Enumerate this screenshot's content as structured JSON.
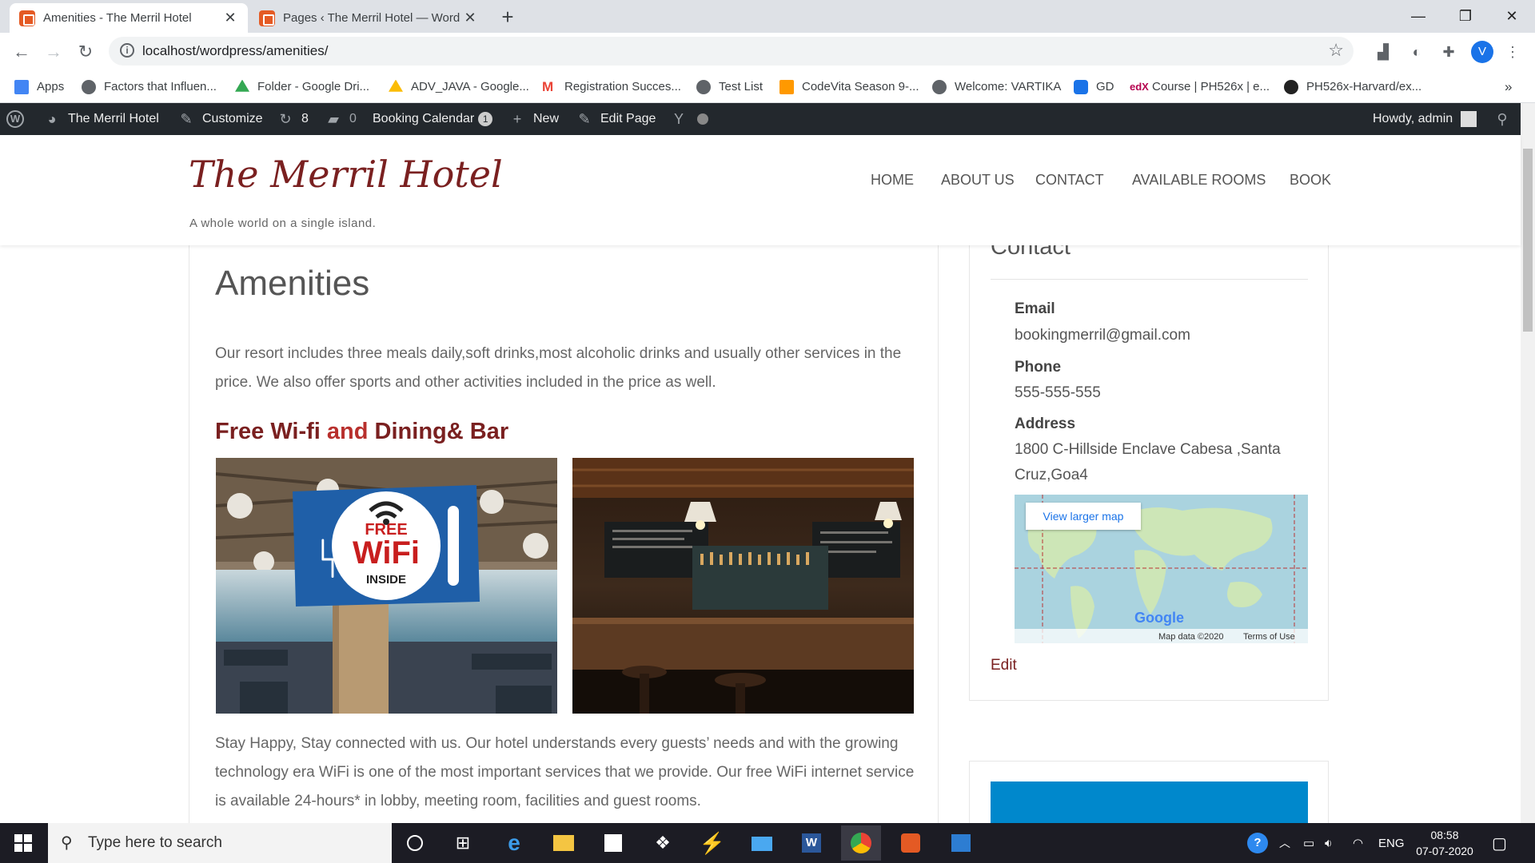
{
  "tabs": [
    {
      "title": "Amenities - The Merril Hotel",
      "close": "✕"
    },
    {
      "title": "Pages ‹ The Merril Hotel — Word",
      "close": "✕"
    }
  ],
  "new_tab_label": "+",
  "window_controls": {
    "minimize": "—",
    "restore": "❐",
    "close": "✕"
  },
  "toolbar": {
    "back": "←",
    "forward": "→",
    "reload": "↻",
    "url": "localhost/wordpress/amenities/",
    "star": "☆",
    "profile_initial": "V"
  },
  "bookmarks": [
    {
      "label": "Apps",
      "color": "#4285f4"
    },
    {
      "label": "Factors that Influen...",
      "color": "#5f6368"
    },
    {
      "label": "Folder - Google Dri...",
      "color": "#34a853"
    },
    {
      "label": "ADV_JAVA - Google...",
      "color": "#fbbc05"
    },
    {
      "label": "Registration Succes...",
      "color": "#ea4335"
    },
    {
      "label": "Test List",
      "color": "#5f6368"
    },
    {
      "label": "CodeVita Season 9-...",
      "color": "#ff9900"
    },
    {
      "label": "Welcome: VARTIKA",
      "color": "#5f6368"
    },
    {
      "label": "GD",
      "color": "#1a73e8"
    },
    {
      "label": "Course | PH526x | e...",
      "color": "#b5004e"
    },
    {
      "label": "PH526x-Harvard/ex...",
      "color": "#222222"
    }
  ],
  "bookmarks_more": "»",
  "adminbar": {
    "site_name": "The Merril Hotel",
    "customize": "Customize",
    "updates": "8",
    "comments": "0",
    "booking_calendar": "Booking Calendar",
    "booking_badge": "1",
    "new": "New",
    "edit_page": "Edit Page",
    "howdy": "Howdy, admin"
  },
  "site": {
    "title": "The Merril Hotel",
    "tagline": "A whole world on a single island.",
    "nav": [
      "HOME",
      "ABOUT US",
      "CONTACT",
      "AVAILABLE ROOMS",
      "BOOK"
    ]
  },
  "content": {
    "page_title": "Amenities",
    "intro": "Our resort includes three meals daily,soft drinks,most alcoholic drinks and usually other services in the price. We also offer sports and other activities included in the price as well.",
    "heading_part1": "Free Wi-fi ",
    "heading_and": "and",
    "heading_part2": " Dining& Bar",
    "wifi_sign_free": "FREE",
    "wifi_sign_wifi": "WiFi",
    "wifi_sign_inside": "INSIDE",
    "para2": "Stay Happy, Stay connected with us. Our hotel understands every guests’ needs and with the growing technology era WiFi is one of the most important services that we provide. Our free WiFi internet service is available 24-hours* in lobby, meeting room, facilities and guest rooms."
  },
  "sidebar": {
    "contact_title": "Contact",
    "email_label": "Email",
    "email": "bookingmerril@gmail.com",
    "phone_label": "Phone",
    "phone": "555-555-555",
    "address_label": "Address",
    "address": "1800 C-Hillside Enclave Cabesa ,Santa Cruz,Goa4",
    "map_button": "View larger map",
    "map_logo": "Google",
    "map_data": "Map data ©2020",
    "map_terms": "Terms of Use",
    "edit": "Edit"
  },
  "taskbar": {
    "search_placeholder": "Type here to search",
    "language": "ENG",
    "time": "08:58",
    "date": "07-07-2020"
  },
  "colors": {
    "brand": "#7a2020",
    "adminbar": "#23282d",
    "accent_blue": "#0088cc"
  }
}
